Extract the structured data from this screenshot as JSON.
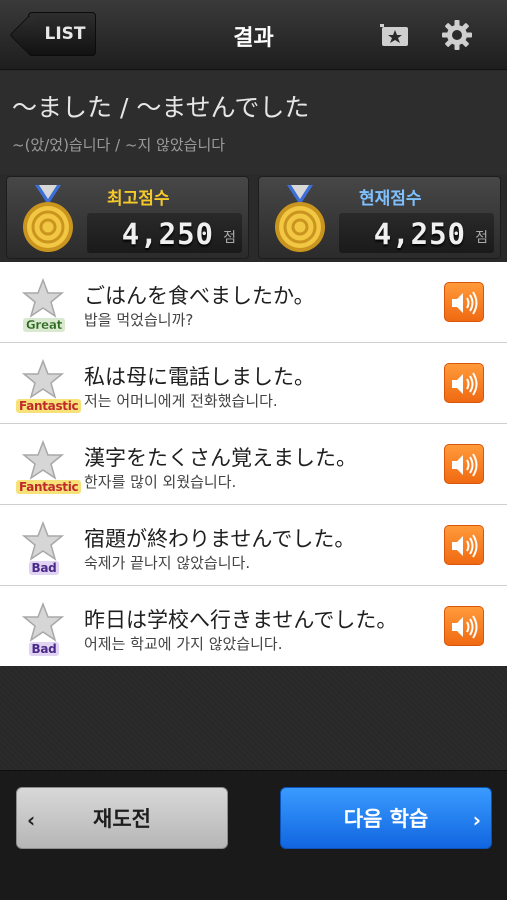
{
  "topbar": {
    "back_label": "LIST",
    "title": "결과",
    "bookmark_icon": "bookmark-star-icon",
    "settings_icon": "gear-icon"
  },
  "header": {
    "title": "〜ました / 〜ませんでした",
    "subtitle": "~(았/었)습니다 / ~지 않았습니다"
  },
  "scores": {
    "best": {
      "label": "최고점수",
      "value": "4,250",
      "unit": "점"
    },
    "current": {
      "label": "현재점수",
      "value": "4,250",
      "unit": "점"
    }
  },
  "items": [
    {
      "jp": "ごはんを食べましたか。",
      "ko": "밥을 먹었습니까?",
      "grade": "Great"
    },
    {
      "jp": "私は母に電話しました。",
      "ko": "저는 어머니에게 전화했습니다.",
      "grade": "Fantastic"
    },
    {
      "jp": "漢字をたくさん覚えました。",
      "ko": "한자를 많이 외웠습니다.",
      "grade": "Fantastic"
    },
    {
      "jp": "宿題が終わりませんでした。",
      "ko": "숙제가 끝나지 않았습니다.",
      "grade": "Bad"
    },
    {
      "jp": "昨日は学校へ行きませんでした。",
      "ko": "어제는 학교에 가지 않았습니다.",
      "grade": "Bad"
    }
  ],
  "bottom": {
    "retry_label": "재도전",
    "next_label": "다음 학습"
  },
  "colors": {
    "best_label": "#f5c92b",
    "current_label": "#7fc0ff",
    "sound_button": "#f47d1e",
    "next_button": "#1e7ff0"
  }
}
